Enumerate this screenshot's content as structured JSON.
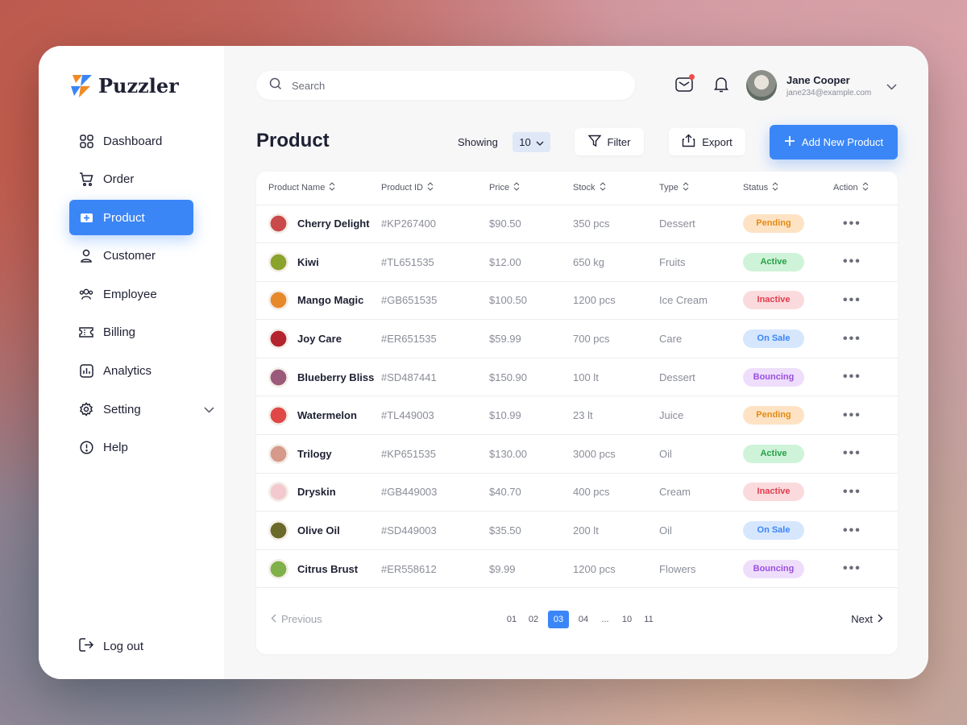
{
  "brand": {
    "name": "Puzzler"
  },
  "sidebar": {
    "items": [
      {
        "label": "Dashboard",
        "icon": "grid-icon"
      },
      {
        "label": "Order",
        "icon": "cart-icon"
      },
      {
        "label": "Product",
        "icon": "product-icon",
        "active": true
      },
      {
        "label": "Customer",
        "icon": "user-icon"
      },
      {
        "label": "Employee",
        "icon": "users-icon"
      },
      {
        "label": "Billing",
        "icon": "ticket-icon"
      },
      {
        "label": "Analytics",
        "icon": "chart-icon"
      },
      {
        "label": "Setting",
        "icon": "gear-icon"
      },
      {
        "label": "Help",
        "icon": "info-icon"
      }
    ],
    "logout_label": "Log out"
  },
  "header": {
    "search_placeholder": "Search",
    "user": {
      "name": "Jane Cooper",
      "email": "jane234@example.com"
    }
  },
  "page": {
    "title": "Product",
    "showing_label": "Showing",
    "showing_value": "10",
    "filter_label": "Filter",
    "export_label": "Export",
    "add_label": "Add New Product"
  },
  "table": {
    "columns": [
      "Product Name",
      "Product ID",
      "Price",
      "Stock",
      "Type",
      "Status",
      "Action"
    ],
    "rows": [
      {
        "name": "Cherry Delight",
        "id": "#KP267400",
        "price": "$90.50",
        "stock": "350 pcs",
        "type": "Dessert",
        "status": "Pending",
        "status_class": "b-pending",
        "thumb": "#c94a4a"
      },
      {
        "name": "Kiwi",
        "id": "#TL651535",
        "price": "$12.00",
        "stock": "650 kg",
        "type": "Fruits",
        "status": "Active",
        "status_class": "b-active",
        "thumb": "#8aa32c"
      },
      {
        "name": "Mango Magic",
        "id": "#GB651535",
        "price": "$100.50",
        "stock": "1200 pcs",
        "type": "Ice Cream",
        "status": "Inactive",
        "status_class": "b-inactive",
        "thumb": "#e6892a"
      },
      {
        "name": "Joy Care",
        "id": "#ER651535",
        "price": "$59.99",
        "stock": "700 pcs",
        "type": "Care",
        "status": "On Sale",
        "status_class": "b-onsale",
        "thumb": "#b3242e"
      },
      {
        "name": "Blueberry Bliss",
        "id": "#SD487441",
        "price": "$150.90",
        "stock": "100 lt",
        "type": "Dessert",
        "status": "Bouncing",
        "status_class": "b-bouncing",
        "thumb": "#9a5a7a"
      },
      {
        "name": "Watermelon",
        "id": "#TL449003",
        "price": "$10.99",
        "stock": "23 lt",
        "type": "Juice",
        "status": "Pending",
        "status_class": "b-pending",
        "thumb": "#e04848"
      },
      {
        "name": "Trilogy",
        "id": "#KP651535",
        "price": "$130.00",
        "stock": "3000 pcs",
        "type": "Oil",
        "status": "Active",
        "status_class": "b-active",
        "thumb": "#d69a8a"
      },
      {
        "name": "Dryskin",
        "id": "#GB449003",
        "price": "$40.70",
        "stock": "400 pcs",
        "type": "Cream",
        "status": "Inactive",
        "status_class": "b-inactive",
        "thumb": "#f2c9cf"
      },
      {
        "name": "Olive Oil",
        "id": "#SD449003",
        "price": "$35.50",
        "stock": "200 lt",
        "type": "Oil",
        "status": "On Sale",
        "status_class": "b-onsale",
        "thumb": "#6b6a2a"
      },
      {
        "name": "Citrus Brust",
        "id": "#ER558612",
        "price": "$9.99",
        "stock": "1200 pcs",
        "type": "Flowers",
        "status": "Bouncing",
        "status_class": "b-bouncing",
        "thumb": "#7fb04a"
      }
    ]
  },
  "pagination": {
    "previous_label": "Previous",
    "next_label": "Next",
    "pages": [
      "01",
      "02",
      "03",
      "04",
      "...",
      "10",
      "11"
    ],
    "current": "03"
  },
  "colors": {
    "accent": "#3b86f7",
    "text": "#1e2033",
    "muted": "#8a8d98"
  }
}
